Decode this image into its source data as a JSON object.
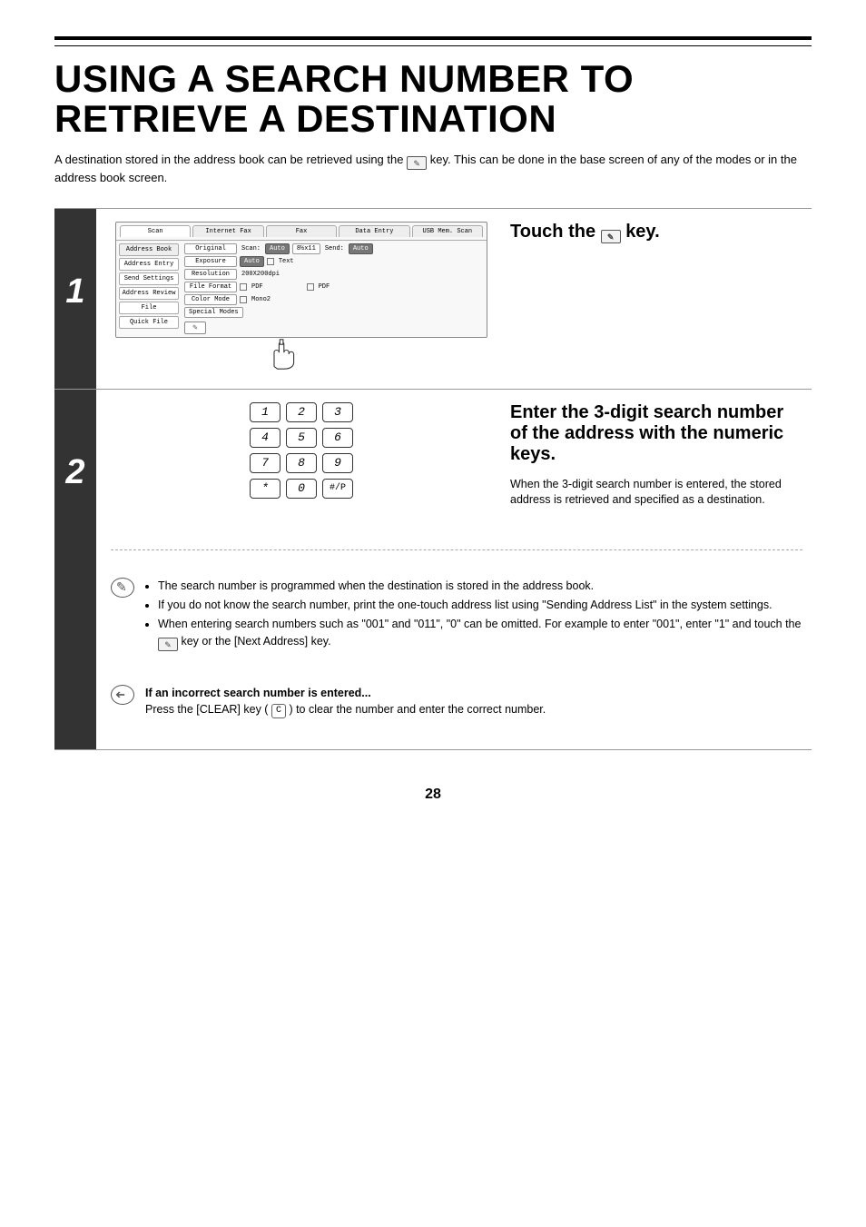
{
  "header": {
    "title": "USING A SEARCH NUMBER TO RETRIEVE A DESTINATION",
    "intro_before": "A destination stored in the address book can be retrieved using the ",
    "intro_after": " key. This can be done in the base screen of any of the modes or in the address book screen."
  },
  "step1": {
    "num": "1",
    "heading_before": "Touch the ",
    "heading_after": " key.",
    "screen": {
      "tabs": [
        "Scan",
        "Internet Fax",
        "Fax",
        "Data Entry",
        "USB Mem. Scan"
      ],
      "active_tab_index": 0,
      "side": [
        "Address Book",
        "Address Entry",
        "Send Settings",
        "Address Review",
        "File",
        "Quick File"
      ],
      "rows": [
        {
          "label": "Original",
          "v1": "Scan:",
          "p1": "Auto",
          "p2": "8½x11",
          "v2": "Send:",
          "p3": "Auto"
        },
        {
          "label": "Exposure",
          "p1": "Auto",
          "icon": true,
          "v1": "Text"
        },
        {
          "label": "Resolution",
          "v1": "200X200dpi"
        },
        {
          "label": "File Format",
          "icon1": true,
          "v1": "PDF",
          "icon2": true,
          "v2": "PDF"
        },
        {
          "label": "Color Mode",
          "icon1": true,
          "v1": "Mono2"
        },
        {
          "label": "Special Modes"
        }
      ]
    }
  },
  "step2": {
    "num": "2",
    "heading": "Enter the 3-digit search number of the address with the numeric keys.",
    "body": "When the 3-digit search number is entered, the stored address is retrieved and specified as a destination.",
    "keys": [
      "1",
      "2",
      "3",
      "4",
      "5",
      "6",
      "7",
      "8",
      "9",
      "*",
      "0",
      "#/P"
    ],
    "notes": [
      "The search number is programmed when the destination is stored in the address book.",
      "If you do not know the search number, print the one-touch address list using \"Sending Address List\" in the system settings.",
      "When entering search numbers such as \"001\" and \"011\", \"0\" can be omitted. For example to enter \"001\", enter \"1\" and touch the  key or the [Next Address] key."
    ],
    "warn_title": "If an incorrect search number is entered...",
    "warn_body_before": "Press the [CLEAR] key (",
    "warn_body_after": ") to clear the number and enter the correct number.",
    "clear_key": "C"
  },
  "page_number": "28"
}
